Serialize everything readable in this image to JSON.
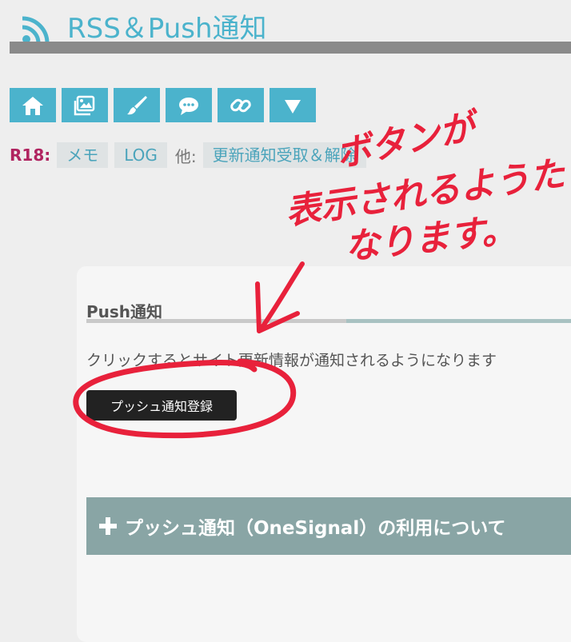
{
  "header": {
    "title": "RSS＆Push通知",
    "icon": "rss-icon",
    "accent_color": "#4bb3cc"
  },
  "toolbar": {
    "buttons": [
      {
        "icon": "home-icon"
      },
      {
        "icon": "image-icon"
      },
      {
        "icon": "brush-icon"
      },
      {
        "icon": "chat-icon"
      },
      {
        "icon": "link-icon"
      },
      {
        "icon": "triangle-down-icon"
      }
    ]
  },
  "tagline": {
    "r18_label": "R18:",
    "tags": [
      "メモ",
      "LOG"
    ],
    "other_label": "他:",
    "update_tag": "更新通知受取＆解除"
  },
  "push_section": {
    "heading": "Push通知",
    "description": "クリックするとサイト更新情報が通知されるようになります",
    "button_label": "プッシュ通知登録"
  },
  "accordion": {
    "label": "プッシュ通知（OneSignal）の利用について"
  },
  "annotation": {
    "line1": "ボタンが",
    "line2": "表示されるようた",
    "line3": "なります。",
    "color": "#e8213b"
  }
}
